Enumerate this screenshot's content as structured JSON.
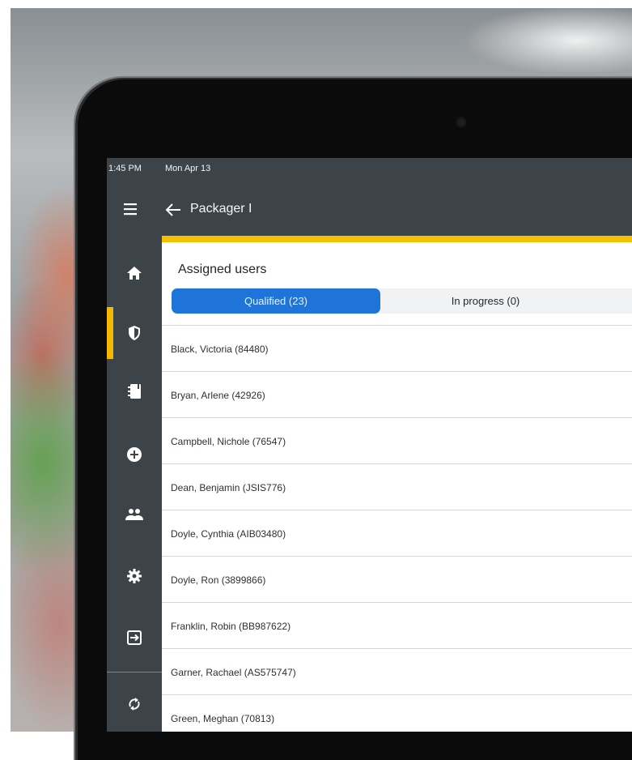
{
  "status_bar": {
    "time": "1:45 PM",
    "date": "Mon Apr 13"
  },
  "header": {
    "title": "Packager I",
    "menu_icon": "hamburger-menu-icon",
    "back_icon": "arrow-left-icon"
  },
  "sidebar": {
    "items": [
      {
        "icon": "home-icon",
        "active": false
      },
      {
        "icon": "shield-icon",
        "active": true
      },
      {
        "icon": "notebook-icon",
        "active": false
      },
      {
        "icon": "add-circle-icon",
        "active": false
      },
      {
        "icon": "people-icon",
        "active": false
      },
      {
        "icon": "gear-icon",
        "active": false
      },
      {
        "icon": "exit-icon",
        "active": false
      },
      {
        "icon": "sync-icon",
        "active": false
      }
    ]
  },
  "main": {
    "section_title": "Assigned users",
    "segments": [
      {
        "label": "Qualified (23)",
        "selected": true
      },
      {
        "label": "In progress (0)",
        "selected": false
      }
    ],
    "users": [
      "Black, Victoria (84480)",
      "Bryan, Arlene (42926)",
      "Campbell, Nichole (76547)",
      "Dean, Benjamin (JSIS776)",
      "Doyle, Cynthia (AIB03480)",
      "Doyle, Ron (3899866)",
      "Franklin, Robin (BB987622)",
      "Garner, Rachael (AS575747)",
      "Green, Meghan (70813)"
    ]
  },
  "colors": {
    "accent_yellow": "#f5c000",
    "primary_blue": "#1f74d9",
    "sidebar_bg": "#3c4449"
  }
}
